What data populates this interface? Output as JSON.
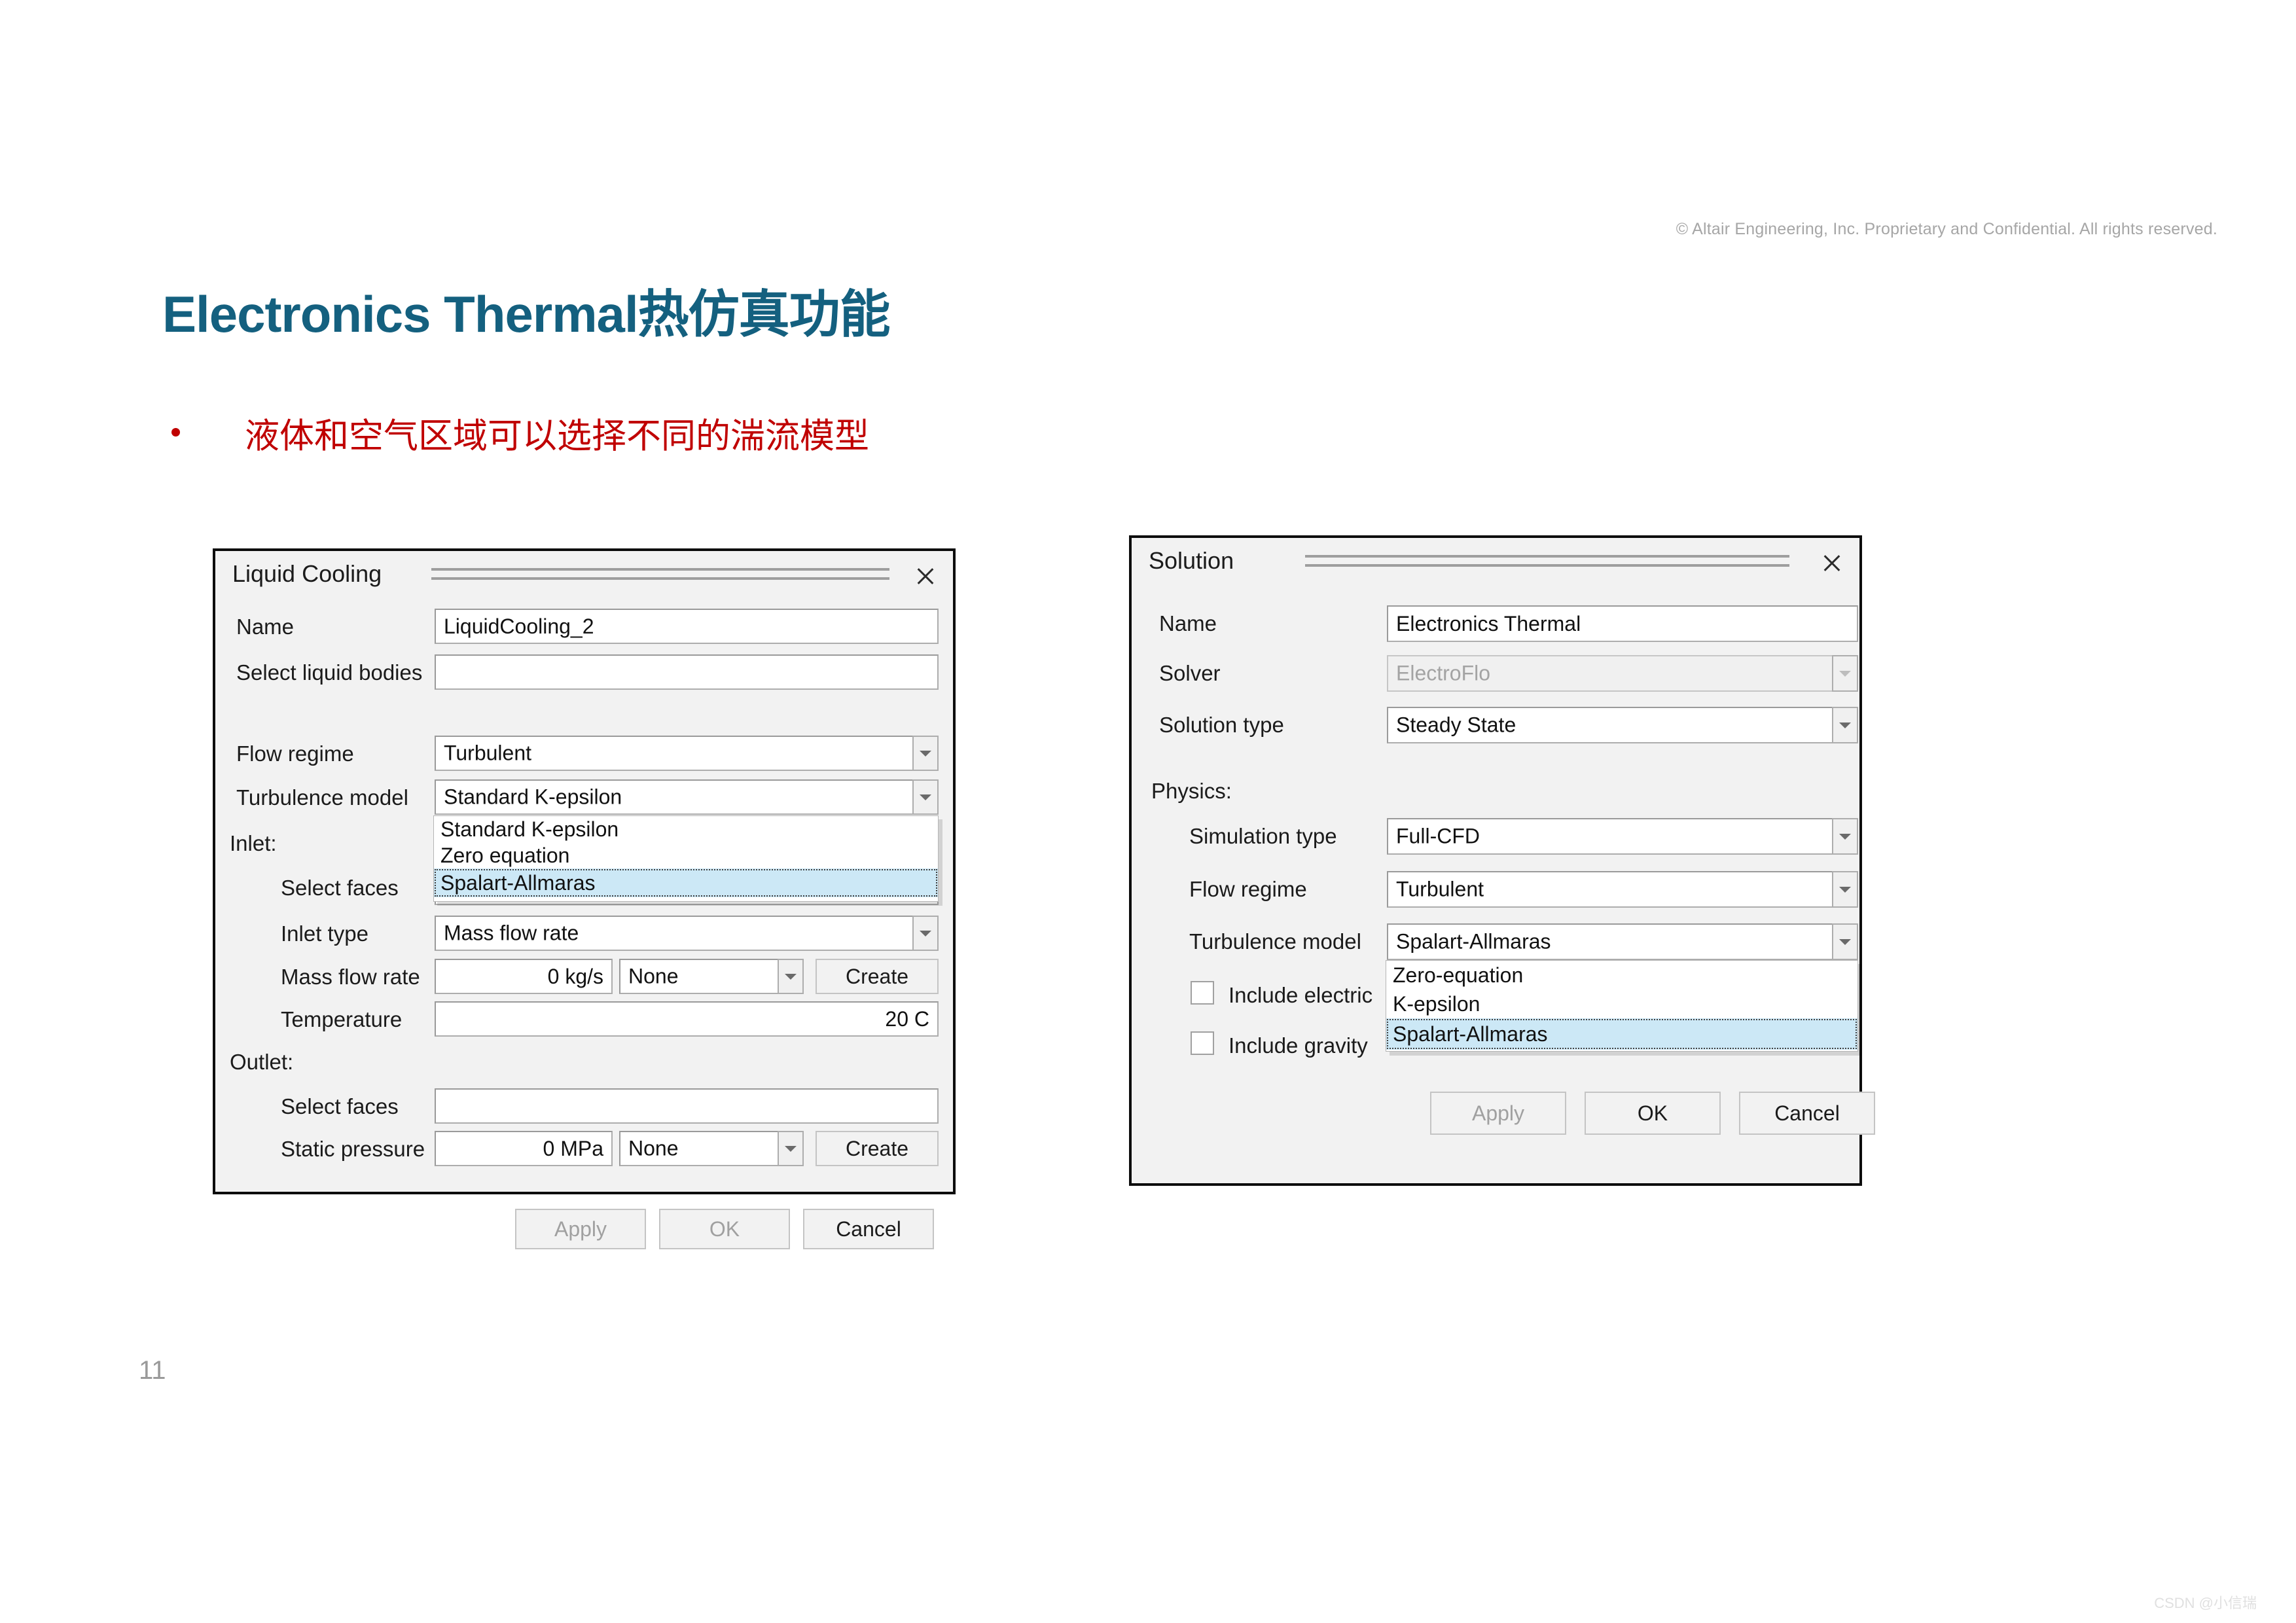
{
  "slide": {
    "copyright": "© Altair Engineering, Inc. Proprietary and Confidential. All rights reserved.",
    "title": "Electronics Thermal热仿真功能",
    "bullet": "液体和空气区域可以选择不同的湍流模型",
    "page_number": "11",
    "watermark": "CSDN @小信瑞",
    "accent_color": "#14607f",
    "bullet_color": "#c00000"
  },
  "liquid_cooling_dialog": {
    "title": "Liquid Cooling",
    "close_icon": "close-icon",
    "fields": {
      "name_label": "Name",
      "name_value": "LiquidCooling_2",
      "select_liquid_bodies_label": "Select liquid bodies",
      "select_liquid_bodies_value": "",
      "flow_regime_label": "Flow regime",
      "flow_regime_value": "Turbulent",
      "turbulence_model_label": "Turbulence model",
      "turbulence_model_value": "Standard K-epsilon",
      "inlet_group_label": "Inlet:",
      "inlet_select_faces_label": "Select faces",
      "inlet_select_faces_value": "",
      "inlet_type_label": "Inlet type",
      "inlet_type_value": "Mass flow rate",
      "mass_flow_rate_label": "Mass flow rate",
      "mass_flow_rate_value": "0 kg/s",
      "mass_flow_rate_curve": "None",
      "mass_flow_rate_create": "Create",
      "temperature_label": "Temperature",
      "temperature_value": "20 C",
      "outlet_group_label": "Outlet:",
      "outlet_select_faces_label": "Select faces",
      "outlet_select_faces_value": "",
      "static_pressure_label": "Static pressure",
      "static_pressure_value": "0 MPa",
      "static_pressure_curve": "None",
      "static_pressure_create": "Create"
    },
    "turbulence_dropdown": {
      "options": [
        "Standard K-epsilon",
        "Zero equation",
        "Spalart-Allmaras"
      ],
      "selected": "Spalart-Allmaras"
    },
    "buttons": {
      "apply": "Apply",
      "ok": "OK",
      "cancel": "Cancel"
    }
  },
  "solution_dialog": {
    "title": "Solution",
    "close_icon": "close-icon",
    "fields": {
      "name_label": "Name",
      "name_value": "Electronics Thermal",
      "solver_label": "Solver",
      "solver_value": "ElectroFlo",
      "solution_type_label": "Solution type",
      "solution_type_value": "Steady State",
      "physics_group_label": "Physics:",
      "simulation_type_label": "Simulation type",
      "simulation_type_value": "Full-CFD",
      "flow_regime_label": "Flow regime",
      "flow_regime_value": "Turbulent",
      "turbulence_model_label": "Turbulence model",
      "turbulence_model_value": "Spalart-Allmaras",
      "include_electric_label": "Include electric",
      "include_gravity_label": "Include gravity"
    },
    "turbulence_dropdown": {
      "options": [
        "Zero-equation",
        "K-epsilon",
        "Spalart-Allmaras"
      ],
      "selected": "Spalart-Allmaras"
    },
    "buttons": {
      "apply": "Apply",
      "ok": "OK",
      "cancel": "Cancel"
    }
  }
}
